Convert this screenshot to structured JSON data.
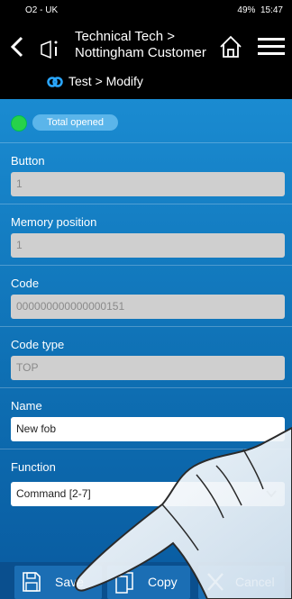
{
  "statusbar": {
    "carrier": "O2 - UK",
    "right_text": "49%",
    "time": "15:47"
  },
  "header": {
    "breadcrumb_line1": "Technical Tech >",
    "breadcrumb_line2": "Nottingham Customer",
    "sub_breadcrumb": "Test > Modify"
  },
  "status": {
    "badge": "Total opened",
    "led_color": "#27d24a"
  },
  "form": {
    "button": {
      "label": "Button",
      "value": "1"
    },
    "memory_position": {
      "label": "Memory position",
      "value": "1"
    },
    "code": {
      "label": "Code",
      "value": "000000000000000151"
    },
    "code_type": {
      "label": "Code type",
      "value": "TOP"
    },
    "name": {
      "label": "Name",
      "value": "New fob"
    },
    "function": {
      "label": "Function",
      "value": "Command [2-7]"
    }
  },
  "toolbar": {
    "save_label": "Save",
    "copy_label": "Copy",
    "cancel_label": "Cancel"
  },
  "icons": {
    "back": "chevron-left-icon",
    "doc": "document-icon",
    "home": "home-icon",
    "menu": "hamburger-menu-icon",
    "link": "link-icon",
    "save": "floppy-disk-icon",
    "copy": "copy-icon",
    "cancel": "close-icon"
  }
}
